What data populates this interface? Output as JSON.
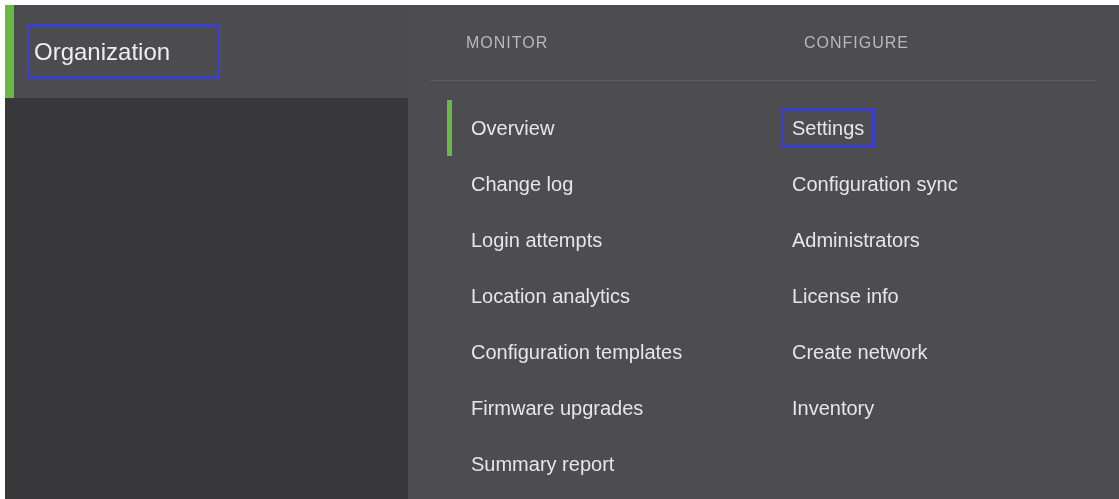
{
  "sidebar": {
    "title": {
      "label": "Organization",
      "selected": true,
      "highlighted": true
    }
  },
  "menu": {
    "columns": [
      {
        "heading": "MONITOR",
        "items": [
          {
            "label": "Overview",
            "selected": true,
            "highlighted": false
          },
          {
            "label": "Change log",
            "selected": false,
            "highlighted": false
          },
          {
            "label": "Login attempts",
            "selected": false,
            "highlighted": false
          },
          {
            "label": "Location analytics",
            "selected": false,
            "highlighted": false
          },
          {
            "label": "Configuration templates",
            "selected": false,
            "highlighted": false
          },
          {
            "label": "Firmware upgrades",
            "selected": false,
            "highlighted": false
          },
          {
            "label": "Summary report",
            "selected": false,
            "highlighted": false
          }
        ]
      },
      {
        "heading": "CONFIGURE",
        "items": [
          {
            "label": "Settings",
            "selected": false,
            "highlighted": true
          },
          {
            "label": "Configuration sync",
            "selected": false,
            "highlighted": false
          },
          {
            "label": "Administrators",
            "selected": false,
            "highlighted": false
          },
          {
            "label": "License info",
            "selected": false,
            "highlighted": false
          },
          {
            "label": "Create network",
            "selected": false,
            "highlighted": false
          },
          {
            "label": "Inventory",
            "selected": false,
            "highlighted": false
          }
        ]
      }
    ]
  }
}
